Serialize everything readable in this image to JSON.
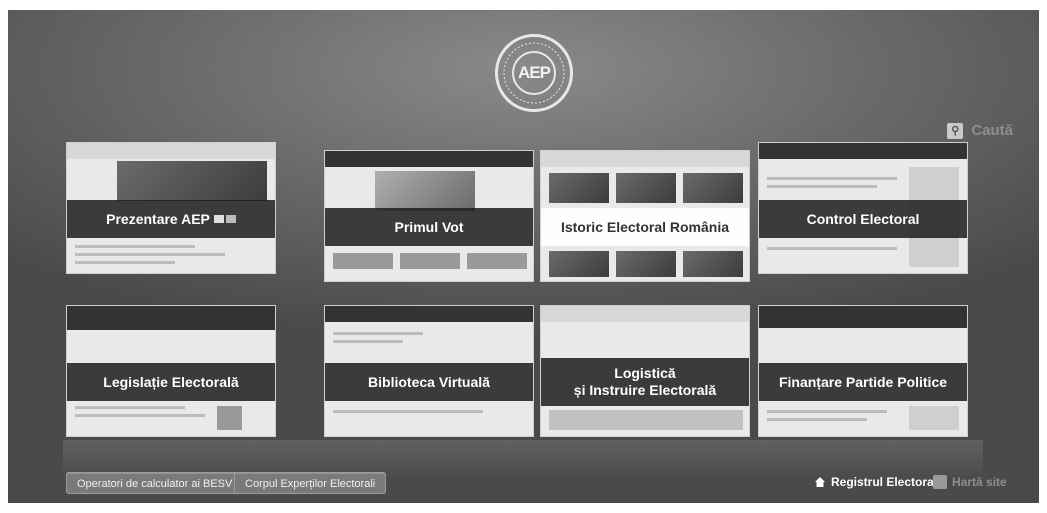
{
  "logo": {
    "monogram": "AEP"
  },
  "search": {
    "label": "Caută",
    "icon": "magnifier-icon"
  },
  "tiles": [
    {
      "label": "Prezentare AEP"
    },
    {
      "label": "Primul Vot"
    },
    {
      "label": "Istoric Electoral România"
    },
    {
      "label": "Control Electoral"
    },
    {
      "label": "Legislație Electorală"
    },
    {
      "label": "Biblioteca Virtuală"
    },
    {
      "label_line1": "Logistică",
      "label_line2": "și Instruire Electorală"
    },
    {
      "label": "Finanțare Partide Politice"
    }
  ],
  "footer": {
    "btn_operatori": "Operatori de calculator ai BESV",
    "btn_corpul": "Corpul Experților Electorali",
    "link_registru": "Registrul Electoral",
    "link_harta": "Hartă site"
  }
}
